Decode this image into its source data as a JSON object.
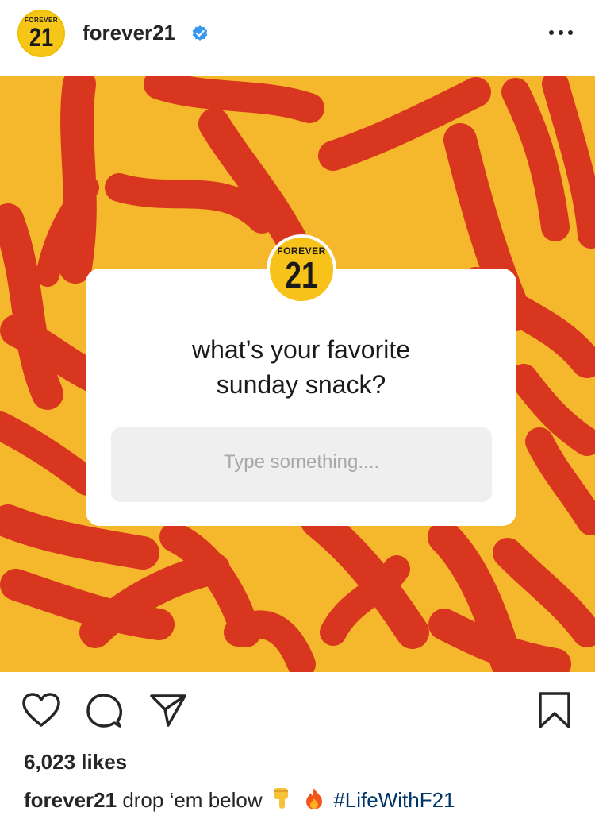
{
  "header": {
    "avatar_brand_small": "FOREVER",
    "avatar_brand_number": "21",
    "username": "forever21",
    "verified_icon": "verified-badge-icon",
    "more_icon": "more-options-icon"
  },
  "post": {
    "logo_brand_small": "FOREVER",
    "logo_brand_number": "21",
    "question_line1": "what’s your favorite",
    "question_line2": "sunday snack?",
    "answer_placeholder": "Type something....",
    "background_color": "#f5b82c",
    "snack_color": "#d8361f"
  },
  "actions": {
    "like_icon": "heart-icon",
    "comment_icon": "comment-icon",
    "share_icon": "share-icon",
    "save_icon": "bookmark-icon"
  },
  "likes_text": "6,023 likes",
  "caption": {
    "username": "forever21",
    "text": "drop ‘em below",
    "emoji_1": "pointing-down-icon",
    "emoji_2": "fire-icon",
    "hashtag": "#LifeWithF21"
  }
}
